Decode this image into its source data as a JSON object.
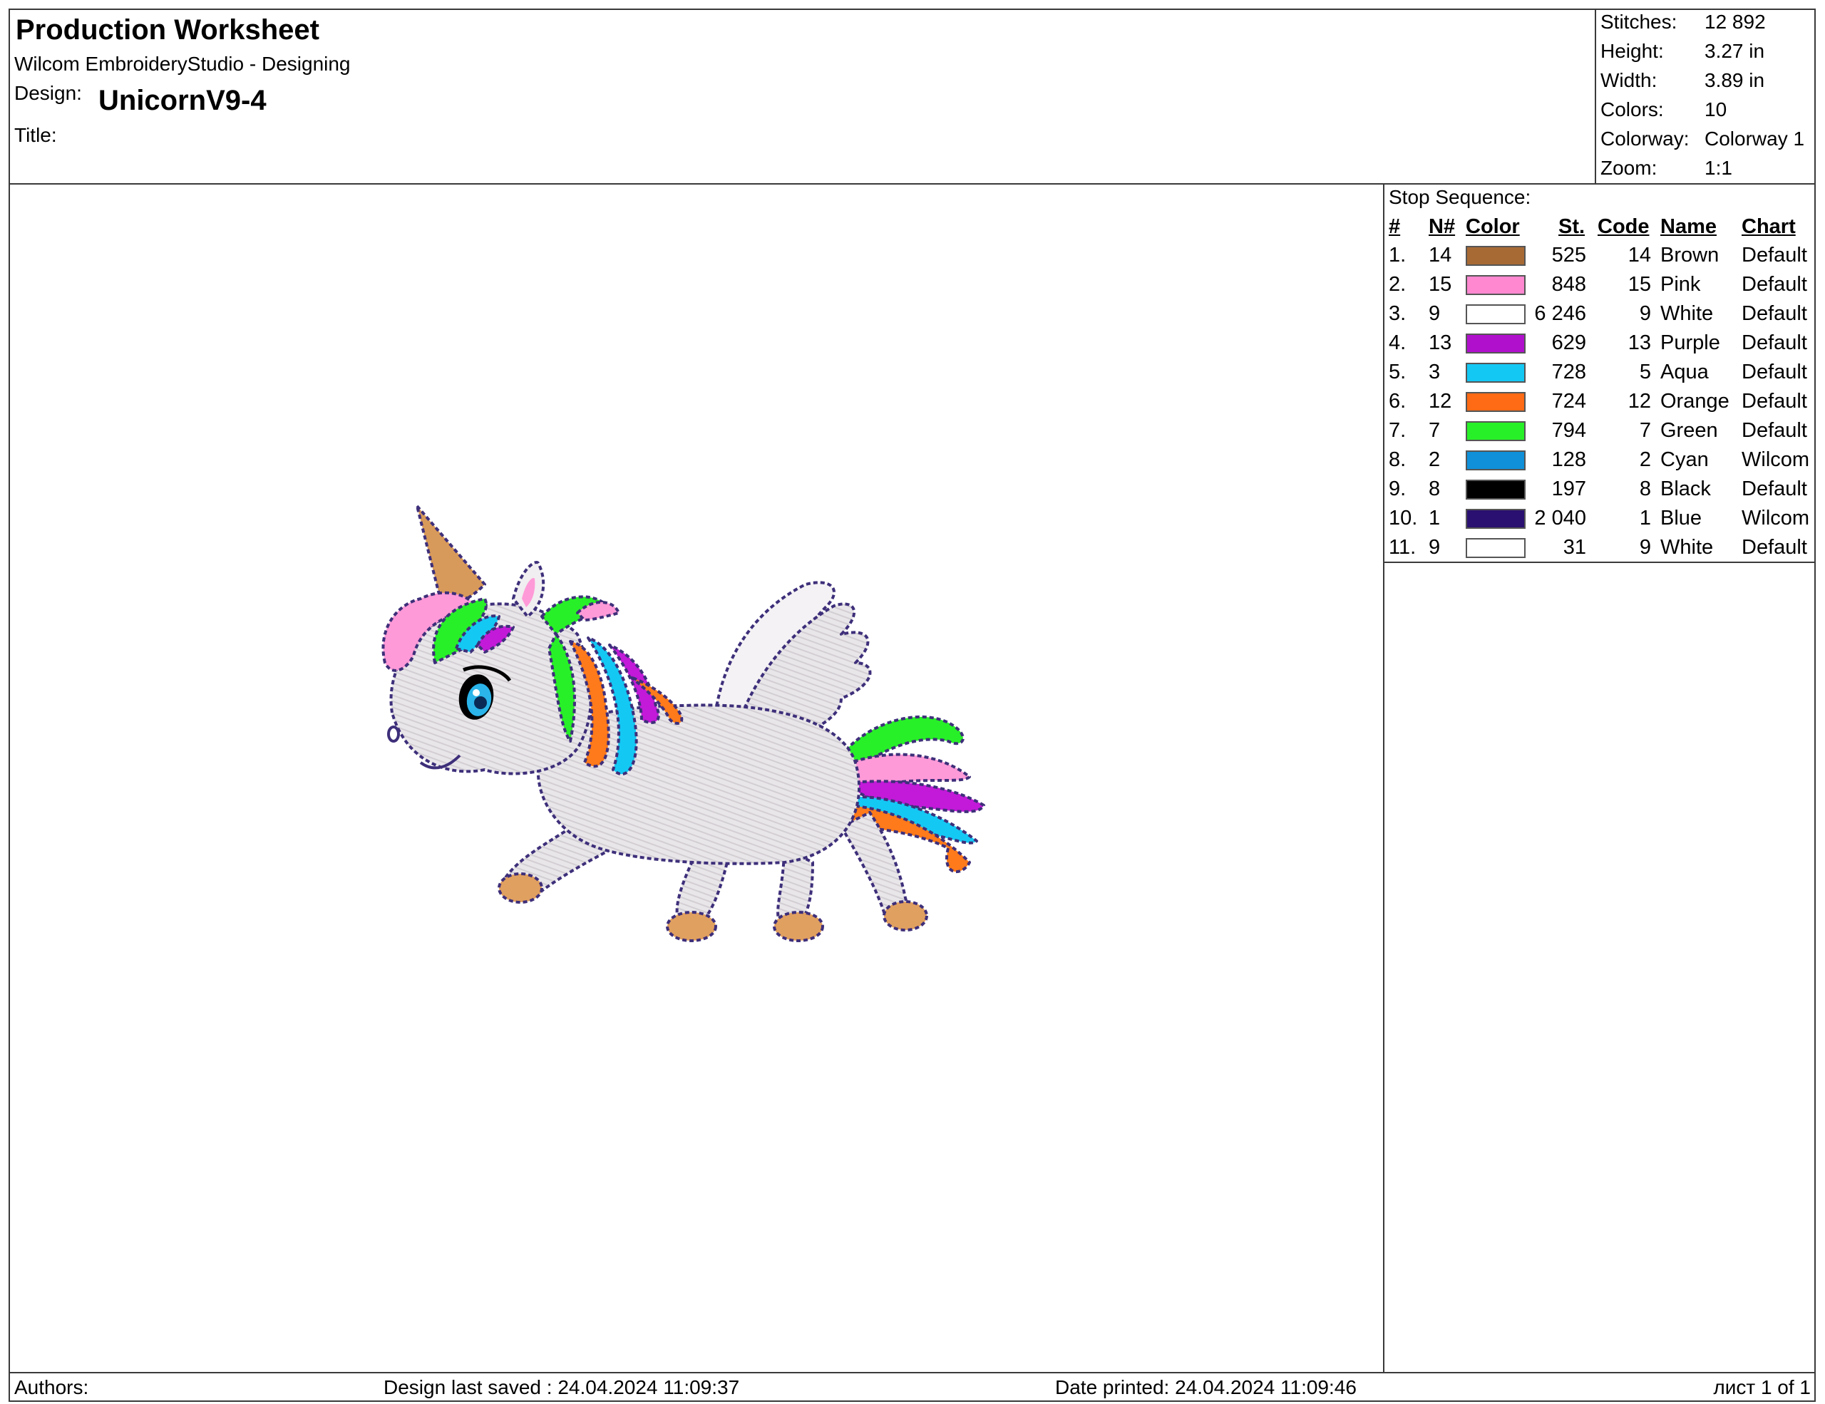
{
  "header": {
    "title": "Production Worksheet",
    "app": "Wilcom EmbroideryStudio - Designing",
    "design_label": "Design:",
    "design_value": "UnicornV9-4",
    "title_label": "Title:",
    "title_value": ""
  },
  "stats": [
    {
      "label": "Stitches:",
      "value": "12 892"
    },
    {
      "label": "Height:",
      "value": "3.27 in"
    },
    {
      "label": "Width:",
      "value": "3.89 in"
    },
    {
      "label": "Colors:",
      "value": "10"
    },
    {
      "label": "Colorway:",
      "value": "Colorway 1"
    },
    {
      "label": "Zoom:",
      "value": "1:1"
    }
  ],
  "stop_sequence": {
    "label": "Stop Sequence:",
    "columns": [
      "#",
      "N#",
      "Color",
      "St.",
      "Code",
      "Name",
      "Chart"
    ],
    "rows": [
      {
        "idx": "1.",
        "n": "14",
        "color": "#A86A35",
        "st": "525",
        "code": "14",
        "name": "Brown",
        "chart": "Default"
      },
      {
        "idx": "2.",
        "n": "15",
        "color": "#FF88D0",
        "st": "848",
        "code": "15",
        "name": "Pink",
        "chart": "Default"
      },
      {
        "idx": "3.",
        "n": "9",
        "color": "#FFFFFF",
        "st": "6 246",
        "code": "9",
        "name": "White",
        "chart": "Default"
      },
      {
        "idx": "4.",
        "n": "13",
        "color": "#B010CC",
        "st": "629",
        "code": "13",
        "name": "Purple",
        "chart": "Default"
      },
      {
        "idx": "5.",
        "n": "3",
        "color": "#14C8F4",
        "st": "728",
        "code": "5",
        "name": "Aqua",
        "chart": "Default"
      },
      {
        "idx": "6.",
        "n": "12",
        "color": "#FF6A14",
        "st": "724",
        "code": "12",
        "name": "Orange",
        "chart": "Default"
      },
      {
        "idx": "7.",
        "n": "7",
        "color": "#28F028",
        "st": "794",
        "code": "7",
        "name": "Green",
        "chart": "Default"
      },
      {
        "idx": "8.",
        "n": "2",
        "color": "#1090D8",
        "st": "128",
        "code": "2",
        "name": "Cyan",
        "chart": "Wilcom"
      },
      {
        "idx": "9.",
        "n": "8",
        "color": "#000000",
        "st": "197",
        "code": "8",
        "name": "Black",
        "chart": "Default"
      },
      {
        "idx": "10.",
        "n": "1",
        "color": "#2A1070",
        "st": "2 040",
        "code": "1",
        "name": "Blue",
        "chart": "Wilcom"
      },
      {
        "idx": "11.",
        "n": "9",
        "color": "#FFFFFF",
        "st": "31",
        "code": "9",
        "name": "White",
        "chart": "Default"
      }
    ]
  },
  "footer": {
    "authors": "Authors:",
    "last_saved": "Design last saved : 24.04.2024 11:09:37",
    "printed": "Date printed: 24.04.2024 11:09:46",
    "page": "лист 1 of 1"
  }
}
